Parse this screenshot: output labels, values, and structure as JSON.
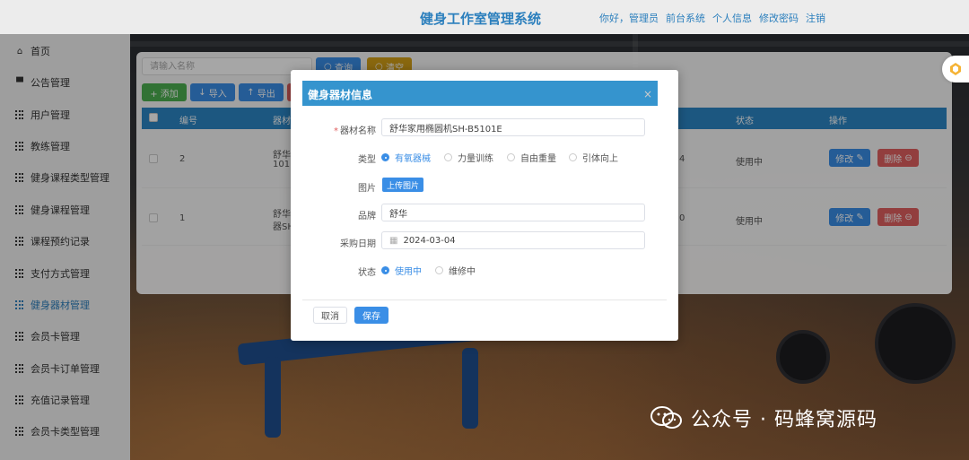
{
  "header": {
    "title": "健身工作室管理系统",
    "greeting": "你好，管理员",
    "links": [
      "前台系统",
      "个人信息",
      "修改密码",
      "注销"
    ]
  },
  "sidebar": {
    "items": [
      {
        "label": "首页",
        "icon": "home-icon"
      },
      {
        "label": "公告管理",
        "icon": "comment-icon"
      },
      {
        "label": "用户管理",
        "icon": "grid-icon"
      },
      {
        "label": "教练管理",
        "icon": "grid-icon"
      },
      {
        "label": "健身课程类型管理",
        "icon": "grid-icon"
      },
      {
        "label": "健身课程管理",
        "icon": "grid-icon"
      },
      {
        "label": "课程预约记录",
        "icon": "grid-icon"
      },
      {
        "label": "支付方式管理",
        "icon": "grid-icon"
      },
      {
        "label": "健身器材管理",
        "icon": "grid-icon"
      },
      {
        "label": "会员卡管理",
        "icon": "grid-icon"
      },
      {
        "label": "会员卡订单管理",
        "icon": "grid-icon"
      },
      {
        "label": "充值记录管理",
        "icon": "grid-icon"
      },
      {
        "label": "会员卡类型管理",
        "icon": "grid-icon"
      }
    ],
    "active_index": 8
  },
  "toolbar": {
    "search_placeholder": "请输入名称",
    "query_label": "查询",
    "reset_label": "清空",
    "add_label": "+ 添加",
    "import_label": "导入",
    "export_label": "导出"
  },
  "table": {
    "headers": [
      "编号",
      "器材",
      "状态",
      "操作"
    ],
    "rows": [
      {
        "id": "2",
        "name_part1": "舒华",
        "name_part2": "101E",
        "tail": "4",
        "status": "使用中"
      },
      {
        "id": "1",
        "name_part1": "舒华",
        "name_part2": "器SH",
        "tail": "0",
        "status": "使用中"
      }
    ],
    "edit_label": "修改",
    "delete_label": "删除"
  },
  "dialog": {
    "title": "健身器材信息",
    "fields": {
      "name_label": "器材名称",
      "name_value": "舒华家用椭圆机SH-B5101E",
      "type_label": "类型",
      "type_options": [
        "有氧器械",
        "力量训练",
        "自由重量",
        "引体向上"
      ],
      "type_selected": 0,
      "image_label": "图片",
      "upload_label": "上传图片",
      "brand_label": "品牌",
      "brand_value": "舒华",
      "date_label": "采购日期",
      "date_value": "2024-03-04",
      "status_label": "状态",
      "status_options": [
        "使用中",
        "维修中"
      ],
      "status_selected": 0
    },
    "cancel_label": "取消",
    "save_label": "保存"
  },
  "watermark": "公众号 · 码蜂窝源码",
  "colors": {
    "primary": "#3a8ee6",
    "header_blue": "#2b86c5",
    "danger": "#e06060",
    "success": "#4caf50",
    "warning": "#d4a017"
  }
}
